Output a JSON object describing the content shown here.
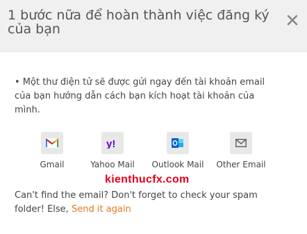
{
  "dialog": {
    "title": "1 bước nữa để hoàn thành việc đăng ký của bạn",
    "close_label": "×"
  },
  "message": "• Một thư điện tử sẽ được gửi ngay đến tài khoản email của bạn hướng dẫn cách bạn kích hoạt tài khoản của mình.",
  "providers": [
    {
      "label": "Gmail",
      "icon": "gmail-icon"
    },
    {
      "label": "Yahoo Mail",
      "icon": "yahoo-icon"
    },
    {
      "label": "Outlook Mail",
      "icon": "outlook-icon"
    },
    {
      "label": "Other Email",
      "icon": "envelope-icon"
    }
  ],
  "watermark": "kienthucfx.com",
  "note": {
    "text": "Can't find the email? Don't forget to check your spam folder! Else, ",
    "link": "Send it again"
  },
  "colors": {
    "header_bg": "#f0f0f0",
    "link": "#e27a1f",
    "watermark": "#e4001b",
    "yahoo": "#5f01d1",
    "outlook": "#0a64c8"
  }
}
